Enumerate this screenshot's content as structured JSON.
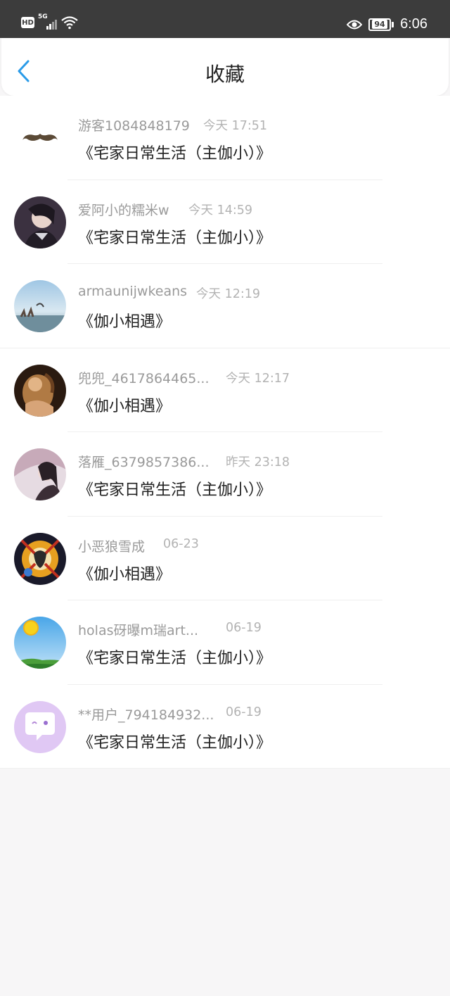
{
  "status_bar": {
    "hd": "HD",
    "network": "5G",
    "battery": "94",
    "time": "6:06"
  },
  "header": {
    "title": "收藏"
  },
  "items": [
    {
      "name": "游客1084848179",
      "time": "今天 17:51",
      "work": "《宅家日常生活（主伽小）》",
      "avatar": "mustache"
    },
    {
      "name": "爱阿小的糯米w",
      "time": "今天 14:59",
      "work": "《宅家日常生活（主伽小）》",
      "avatar": "anime-dark"
    },
    {
      "name": "armaunijwkeans",
      "time": "今天 12:19",
      "work": "《伽小相遇》",
      "avatar": "sky-sea"
    },
    {
      "name": "兜兜_4617864465...",
      "time": "今天 12:17",
      "work": "《伽小相遇》",
      "avatar": "painting"
    },
    {
      "name": "落雁_6379857386...",
      "time": "昨天 23:18",
      "work": "《宅家日常生活（主伽小）》",
      "avatar": "girl-pink"
    },
    {
      "name": "小恶狼雪成",
      "time": "06-23",
      "work": "《伽小相遇》",
      "avatar": "colorful"
    },
    {
      "name": "holas砑曝m瑞art...",
      "time": "06-19",
      "work": "《宅家日常生活（主伽小）》",
      "avatar": "sun-sky"
    },
    {
      "name": "**用户_794184932...",
      "time": "06-19",
      "work": "《宅家日常生活（主伽小）》",
      "avatar": "chat-bubble"
    }
  ]
}
